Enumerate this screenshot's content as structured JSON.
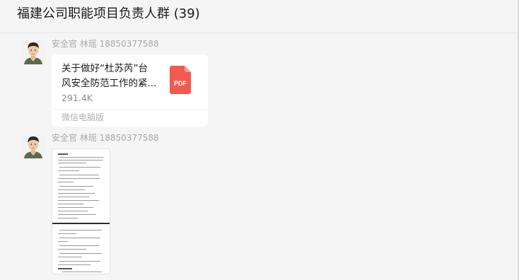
{
  "header": {
    "chat_title": "福建公司职能项目负责人群 (39)"
  },
  "messages": [
    {
      "sender": "安全官 林瑶 18850377588",
      "avatar_icon": "cartoon-man-avatar",
      "type": "file",
      "file": {
        "name_line1": "关于做好“杜苏芮”台",
        "name_line2": "风安全防范工作的紧...",
        "size": "291.4K",
        "file_type": "PDF",
        "source": "微信电脑版"
      }
    },
    {
      "sender": "安全官 林瑶 18850377588",
      "avatar_icon": "cartoon-man-avatar",
      "type": "image",
      "image_icon": "document-screenshot"
    }
  ],
  "colors": {
    "pdf_red": "#f05a4f",
    "background": "#f5f5f5",
    "bubble": "#ffffff"
  }
}
